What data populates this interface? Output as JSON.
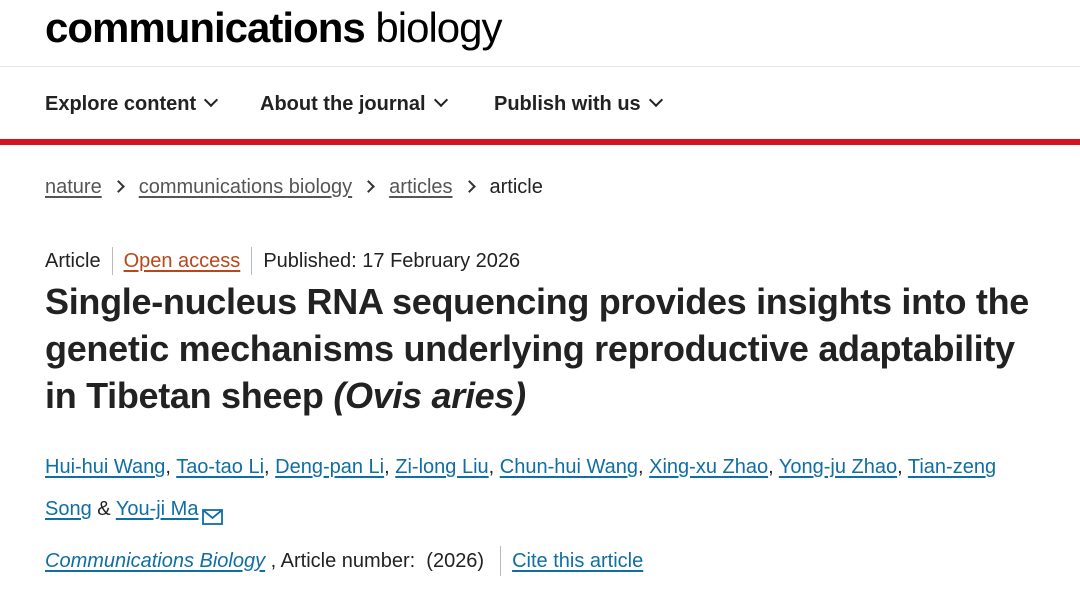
{
  "logo": {
    "bold": "communications",
    "light": "biology"
  },
  "nav": [
    {
      "label": "Explore content"
    },
    {
      "label": "About the journal"
    },
    {
      "label": "Publish with us"
    }
  ],
  "breadcrumb": {
    "items": [
      "nature",
      "communications biology",
      "articles"
    ],
    "current": "article"
  },
  "meta": {
    "type": "Article",
    "access": "Open access",
    "published": "Published: 17 February 2026"
  },
  "title": {
    "main": "Single-nucleus RNA sequencing provides insights into the genetic mechanisms underlying reproductive adaptability in Tibetan sheep",
    "species": "(Ovis aries)"
  },
  "authors": [
    "Hui-hui Wang",
    "Tao-tao Li",
    "Deng-pan Li",
    "Zi-long Liu",
    "Chun-hui Wang",
    "Xing-xu Zhao",
    "Yong-ju Zhao",
    "Tian-zeng Song",
    "You-ji Ma"
  ],
  "author_sep": ", ",
  "author_and": " & ",
  "citation": {
    "journal": "Communications Biology",
    "article_number": " , Article number:  (2026)",
    "cite_link": "Cite this article"
  },
  "colors": {
    "accent_red": "#d9101f",
    "link_blue": "#0f6ea4",
    "open_access": "#b9471a"
  },
  "icons": {
    "nav_chevron": "chevron-down-icon",
    "crumb_sep": "chevron-right-icon",
    "mail": "mail-icon"
  }
}
